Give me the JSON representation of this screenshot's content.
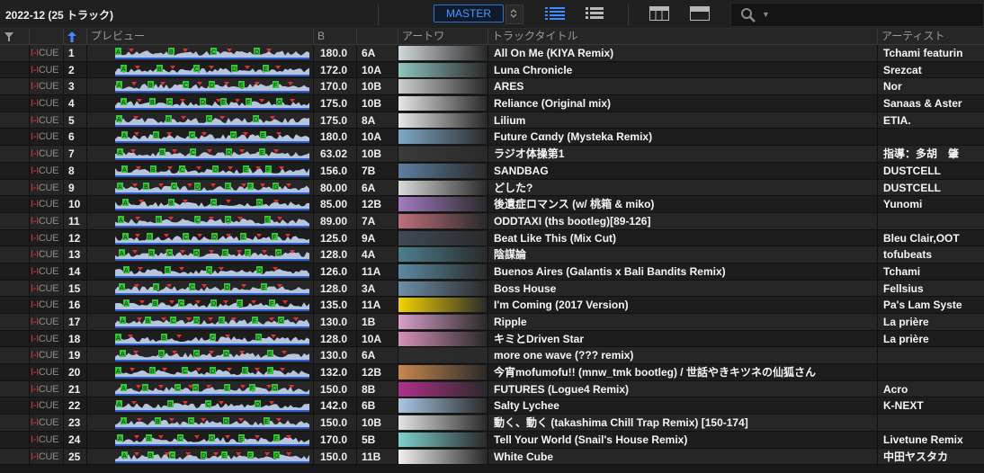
{
  "playlist": {
    "title": "2022-12 (25 トラック)"
  },
  "toolbar": {
    "master_label": "MASTER"
  },
  "columns": {
    "preview": "プレビュー",
    "bpm": "B",
    "artwork": "アートワ",
    "title": "トラックタイトル",
    "artist": "アーティスト"
  },
  "cue_label": "CUE",
  "tracks": [
    {
      "no": "1",
      "bpm": "180.0",
      "key": "6A",
      "title": "All On Me (KIYA Remix)",
      "artist": "Tchami featurin",
      "art": "#d0d8dc"
    },
    {
      "no": "2",
      "bpm": "172.0",
      "key": "10A",
      "title": "Luna Chronicle",
      "artist": "Srezcat",
      "art": "#8fc4bf"
    },
    {
      "no": "3",
      "bpm": "170.0",
      "key": "10B",
      "title": "ARES",
      "artist": "Nor",
      "art": "#cfcfcf"
    },
    {
      "no": "4",
      "bpm": "175.0",
      "key": "10B",
      "title": "Reliance (Original mix)",
      "artist": "Sanaas & Aster",
      "art": "#e6e6e6"
    },
    {
      "no": "5",
      "bpm": "175.0",
      "key": "8A",
      "title": "Lilium",
      "artist": "ETIA.",
      "art": "#e8e8e8"
    },
    {
      "no": "6",
      "bpm": "180.0",
      "key": "10A",
      "title": "Future Cαndy (Mysteka Remix)",
      "artist": "",
      "art": "#7fa9c7"
    },
    {
      "no": "7",
      "bpm": "63.02",
      "key": "10B",
      "title": "ラジオ体操第1",
      "artist": "指導：多胡　肇",
      "art": "#3a3a3a"
    },
    {
      "no": "8",
      "bpm": "156.0",
      "key": "7B",
      "title": "SANDBAG",
      "artist": "DUSTCELL",
      "art": "#5c7fa0"
    },
    {
      "no": "9",
      "bpm": "80.00",
      "key": "6A",
      "title": "どした?",
      "artist": "DUSTCELL",
      "art": "#dadada"
    },
    {
      "no": "10",
      "bpm": "85.00",
      "key": "12B",
      "title": "後遺症ロマンス (w/ 桃箱 & miko)",
      "artist": "Yunomi",
      "art": "#a27ac2"
    },
    {
      "no": "11",
      "bpm": "89.00",
      "key": "7A",
      "title": "ODDTAXI (ths bootleg)[89-126]",
      "artist": "",
      "art": "#c06f7a"
    },
    {
      "no": "12",
      "bpm": "125.0",
      "key": "9A",
      "title": "Beat Like This (Mix Cut)",
      "artist": "Bleu Clair,OOT",
      "art": "#3f4a57"
    },
    {
      "no": "13",
      "bpm": "128.0",
      "key": "4A",
      "title": "陰謀論",
      "artist": "tofubeats",
      "art": "#4c7f8f"
    },
    {
      "no": "14",
      "bpm": "126.0",
      "key": "11A",
      "title": "Buenos Aires (Galantis x Bali Bandits Remix)",
      "artist": "Tchami",
      "art": "#5b8aa2"
    },
    {
      "no": "15",
      "bpm": "128.0",
      "key": "3A",
      "title": "Boss House",
      "artist": "Fellsius",
      "art": "#6d8fa9"
    },
    {
      "no": "16",
      "bpm": "135.0",
      "key": "11A",
      "title": "I'm Coming (2017 Version)",
      "artist": "Pa's Lam Syste",
      "art": "#f3d200"
    },
    {
      "no": "17",
      "bpm": "130.0",
      "key": "1B",
      "title": "Ripple",
      "artist": "La prière",
      "art": "#d7a0c8"
    },
    {
      "no": "18",
      "bpm": "128.0",
      "key": "10A",
      "title": "キミとDriven Star",
      "artist": "La prière",
      "art": "#d690b8"
    },
    {
      "no": "19",
      "bpm": "130.0",
      "key": "6A",
      "title": "more one wave (??? remix)",
      "artist": "",
      "art": "#2c2c2c"
    },
    {
      "no": "20",
      "bpm": "132.0",
      "key": "12B",
      "title": "今宵mofumofu!! (mnw_tmk bootleg) / 世話やきキツネの仙狐さん",
      "artist": "",
      "art": "#c8874d"
    },
    {
      "no": "21",
      "bpm": "150.0",
      "key": "8B",
      "title": "FUTURES (Logue4 Remix)",
      "artist": "Acro",
      "art": "#b0308a"
    },
    {
      "no": "22",
      "bpm": "142.0",
      "key": "6B",
      "title": "Salty Lychee",
      "artist": "K-NEXT",
      "art": "#a9c6e3"
    },
    {
      "no": "23",
      "bpm": "150.0",
      "key": "10B",
      "title": "動く、動く (takashima Chill Trap Remix) [150-174]",
      "artist": "",
      "art": "#e4e4e4"
    },
    {
      "no": "24",
      "bpm": "170.0",
      "key": "5B",
      "title": "Tell Your World (Snail's House Remix)",
      "artist": "Livetune Remix",
      "art": "#7ed0d0"
    },
    {
      "no": "25",
      "bpm": "150.0",
      "key": "11B",
      "title": "White Cube",
      "artist": "中田ヤスタカ",
      "art": "#f0f0f0"
    }
  ]
}
